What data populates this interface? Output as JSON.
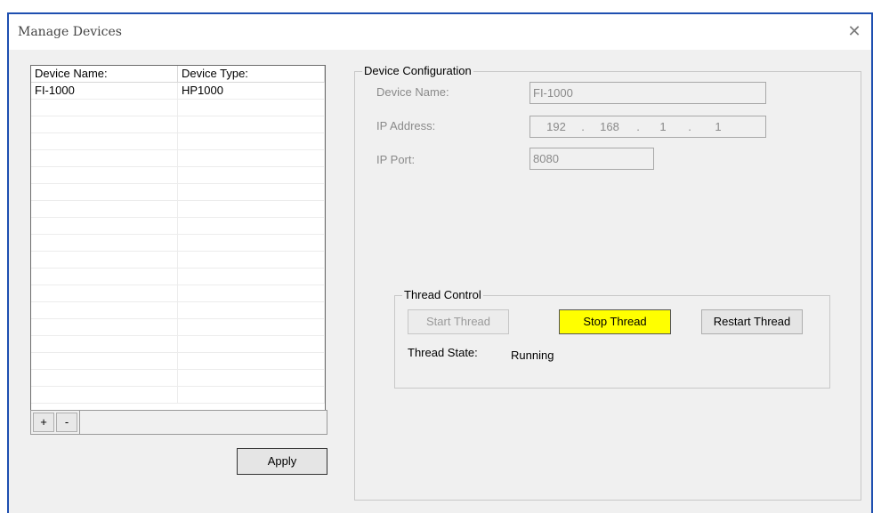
{
  "window": {
    "title": "Manage Devices",
    "close_glyph": "✕"
  },
  "device_list": {
    "columns": [
      "Device Name:",
      "Device Type:"
    ],
    "rows": [
      {
        "name": "FI-1000",
        "type": "HP1000"
      }
    ],
    "add_label": "+",
    "remove_label": "-",
    "apply_label": "Apply"
  },
  "device_config": {
    "group_title": "Device Configuration",
    "device_name_label": "Device Name:",
    "device_name_value": "FI-1000",
    "ip_address_label": "IP Address:",
    "ip_octets": [
      "192",
      "168",
      "1",
      "1"
    ],
    "ip_port_label": "IP Port:",
    "ip_port_value": "8080"
  },
  "thread_control": {
    "group_title": "Thread Control",
    "start_label": "Start Thread",
    "stop_label": "Stop Thread",
    "restart_label": "Restart Thread",
    "state_label": "Thread State:",
    "state_value": "Running"
  },
  "colors": {
    "highlight": "#ffff00",
    "window_border": "#1e4fb0",
    "dialog_bg": "#f0f0f0"
  }
}
